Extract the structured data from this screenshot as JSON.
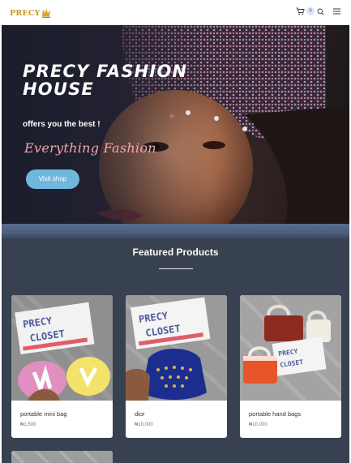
{
  "header": {
    "logo_text": "PRECY",
    "cart_count": "0",
    "icons": [
      "cart-icon",
      "search-icon",
      "menu-icon"
    ]
  },
  "hero": {
    "title": "PRECY FASHION HOUSE",
    "subtitle": "offers you the best !",
    "tagline": "Everything Fashion",
    "button_label": "Visit shop"
  },
  "featured": {
    "title": "Featured Products",
    "products": [
      {
        "name": "portable mini bag",
        "price": "₦1,500"
      },
      {
        "name": "dior",
        "price": "₦10,000"
      },
      {
        "name": "portable hand bags",
        "price": "₦10,000"
      }
    ],
    "lightbox_text": "PRECY CLOSET"
  },
  "colors": {
    "accent_button": "#6fb7dc",
    "tagline_pink": "#f0a7b0",
    "page_background": "#37414f",
    "logo_gold": "#c99a1e"
  }
}
